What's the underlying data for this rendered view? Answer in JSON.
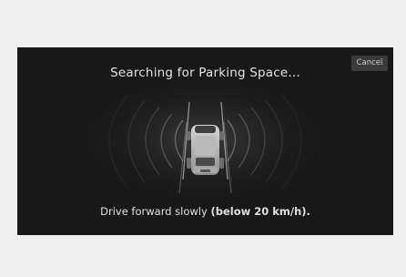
{
  "screen": {
    "title": "Searching for Parking Space...",
    "cancel_label": "Cancel",
    "instruction": "Drive forward slowly",
    "speed_note": "(below 20 km/h)."
  }
}
